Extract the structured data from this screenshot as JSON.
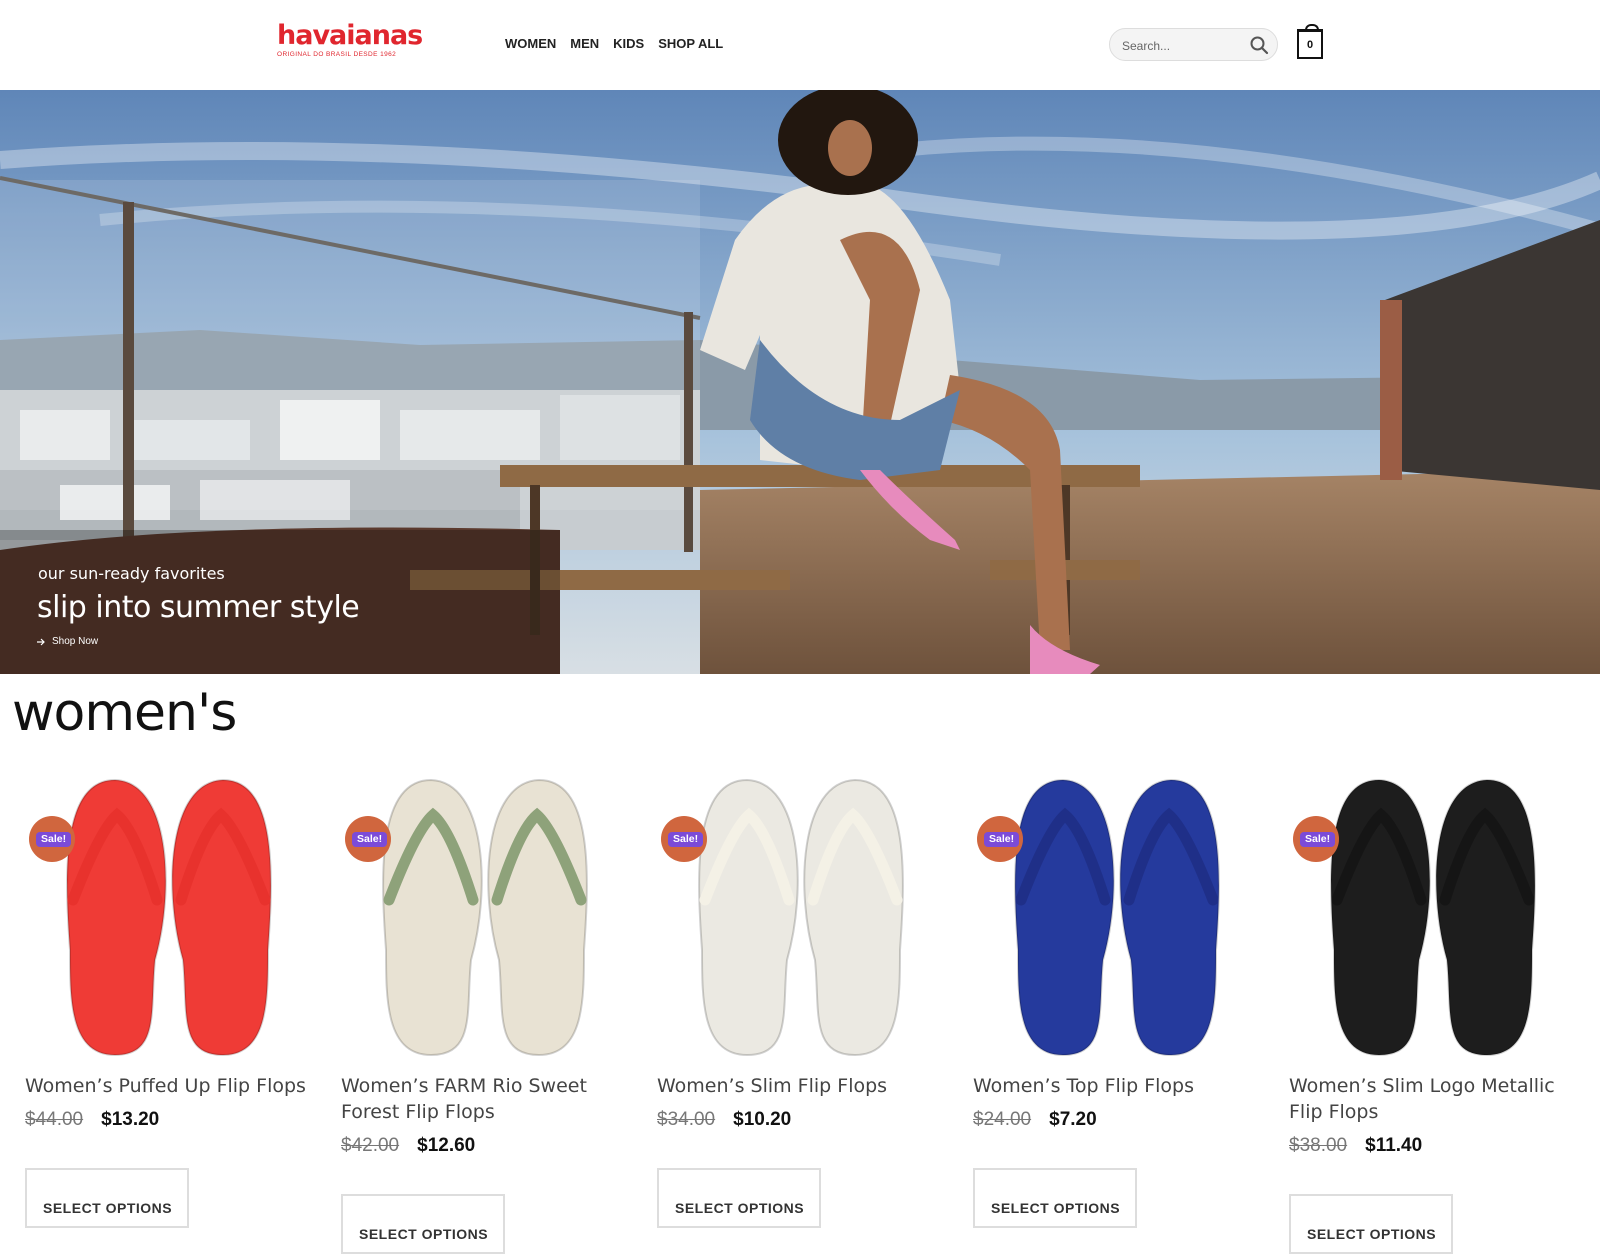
{
  "brand": {
    "name": "havaianas",
    "tagline": "ORIGINAL DO BRASIL DESDE 1962",
    "color": "#e0262e"
  },
  "nav": {
    "items": [
      "WOMEN",
      "MEN",
      "KIDS",
      "SHOP ALL"
    ]
  },
  "search": {
    "placeholder": "Search...",
    "icon": "search-icon"
  },
  "cart": {
    "count": "0",
    "icon": "cart-icon"
  },
  "hero": {
    "kicker": "our sun-ready favorites",
    "headline": "slip into summer style",
    "cta": "Shop Now",
    "cta_icon": "arrow-right-icon"
  },
  "section": {
    "title": "women's"
  },
  "sale_badge": "Sale!",
  "products": [
    {
      "name": "Women’s Puffed Up Flip Flops",
      "old_price": "$44.00",
      "price": "$13.20",
      "button": "SELECT OPTIONS",
      "color": "#ef3b36",
      "strap": "#e8322d"
    },
    {
      "name": "Women’s FARM Rio Sweet Forest Flip Flops",
      "old_price": "$42.00",
      "price": "$12.60",
      "button": "SELECT OPTIONS",
      "color": "#e8e2d3",
      "strap": "#8ea27a"
    },
    {
      "name": "Women’s Slim Flip Flops",
      "old_price": "$34.00",
      "price": "$10.20",
      "button": "SELECT OPTIONS",
      "color": "#ebe9e2",
      "strap": "#f4f1e6"
    },
    {
      "name": "Women’s Top Flip Flops",
      "old_price": "$24.00",
      "price": "$7.20",
      "button": "SELECT OPTIONS",
      "color": "#253a9d",
      "strap": "#1f2f88"
    },
    {
      "name": "Women’s Slim Logo Metallic Flip Flops",
      "old_price": "$38.00",
      "price": "$11.40",
      "button": "SELECT OPTIONS",
      "color": "#1d1d1d",
      "strap": "#151515"
    }
  ]
}
